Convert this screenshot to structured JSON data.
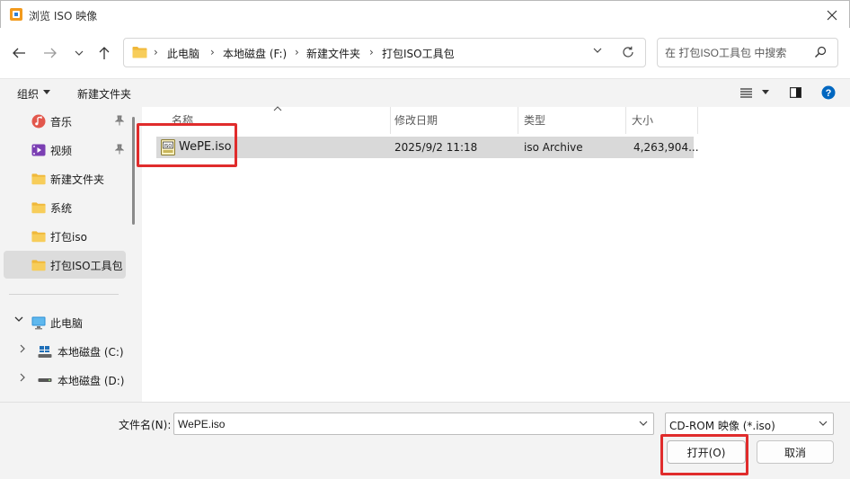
{
  "window": {
    "title": "浏览 ISO 映像"
  },
  "address": {
    "crumbs": [
      "此电脑",
      "本地磁盘 (F:)",
      "新建文件夹",
      "打包ISO工具包"
    ],
    "search_placeholder": "在 打包ISO工具包 中搜索"
  },
  "toolbar": {
    "organize": "组织",
    "new_folder": "新建文件夹"
  },
  "sidebar": {
    "items": [
      {
        "label": "音乐",
        "icon": "music-icon",
        "pinned": true
      },
      {
        "label": "视频",
        "icon": "video-icon",
        "pinned": true
      },
      {
        "label": "新建文件夹",
        "icon": "folder-icon"
      },
      {
        "label": "系统",
        "icon": "folder-icon"
      },
      {
        "label": "打包iso",
        "icon": "folder-icon"
      },
      {
        "label": "打包ISO工具包",
        "icon": "folder-icon",
        "selected": true
      }
    ],
    "tree": [
      {
        "label": "此电脑",
        "icon": "computer-icon",
        "expanded": true
      },
      {
        "label": "本地磁盘 (C:)",
        "icon": "drive-c-icon"
      },
      {
        "label": "本地磁盘 (D:)",
        "icon": "drive-icon"
      }
    ]
  },
  "columns": {
    "name": "名称",
    "date": "修改日期",
    "type": "类型",
    "size": "大小"
  },
  "files": [
    {
      "name": "WePE.iso",
      "date": "2025/9/2 11:18",
      "type": "iso Archive",
      "size": "4,263,904..."
    }
  ],
  "footer": {
    "filename_label": "文件名(N):",
    "filename_value": "WePE.iso",
    "filetype_value": "CD-ROM 映像 (*.iso)",
    "open_label": "打开(O)",
    "cancel_label": "取消"
  },
  "colors": {
    "annotation": "#e02c2c",
    "selection": "#d9d9d9",
    "accent": "#0067c0"
  }
}
